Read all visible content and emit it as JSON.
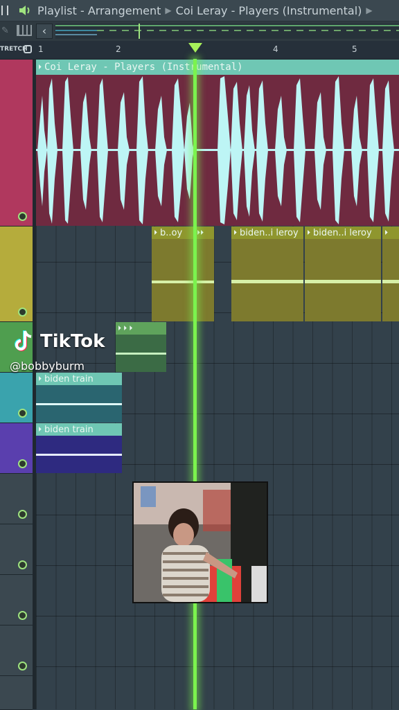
{
  "titlebar": {
    "window_title": "Playlist - Arrangement",
    "pattern": "Coi Leray - Players (Instrumental)"
  },
  "toolbar": {
    "stretch_label": "TRETCH"
  },
  "ruler": {
    "bars": [
      "1",
      "2",
      "4",
      "5"
    ]
  },
  "clips": {
    "main": "Coi Leray - Players (Instrumental)",
    "vocal_a": "b..oy",
    "vocal_b": "biden..i leroy",
    "vocal_c": "biden..i leroy",
    "train_1": "biden train",
    "train_2": "biden train"
  },
  "overlay": {
    "brand": "TikTok",
    "handle": "@bobbyburm"
  },
  "colors": {
    "accent": "#7bf34e",
    "track_main": "#b0385e",
    "track_vocal": "#b5ac3c",
    "track_green": "#4f9e4f",
    "track_teal": "#3aa3ad",
    "track_purple": "#5a3fae"
  }
}
